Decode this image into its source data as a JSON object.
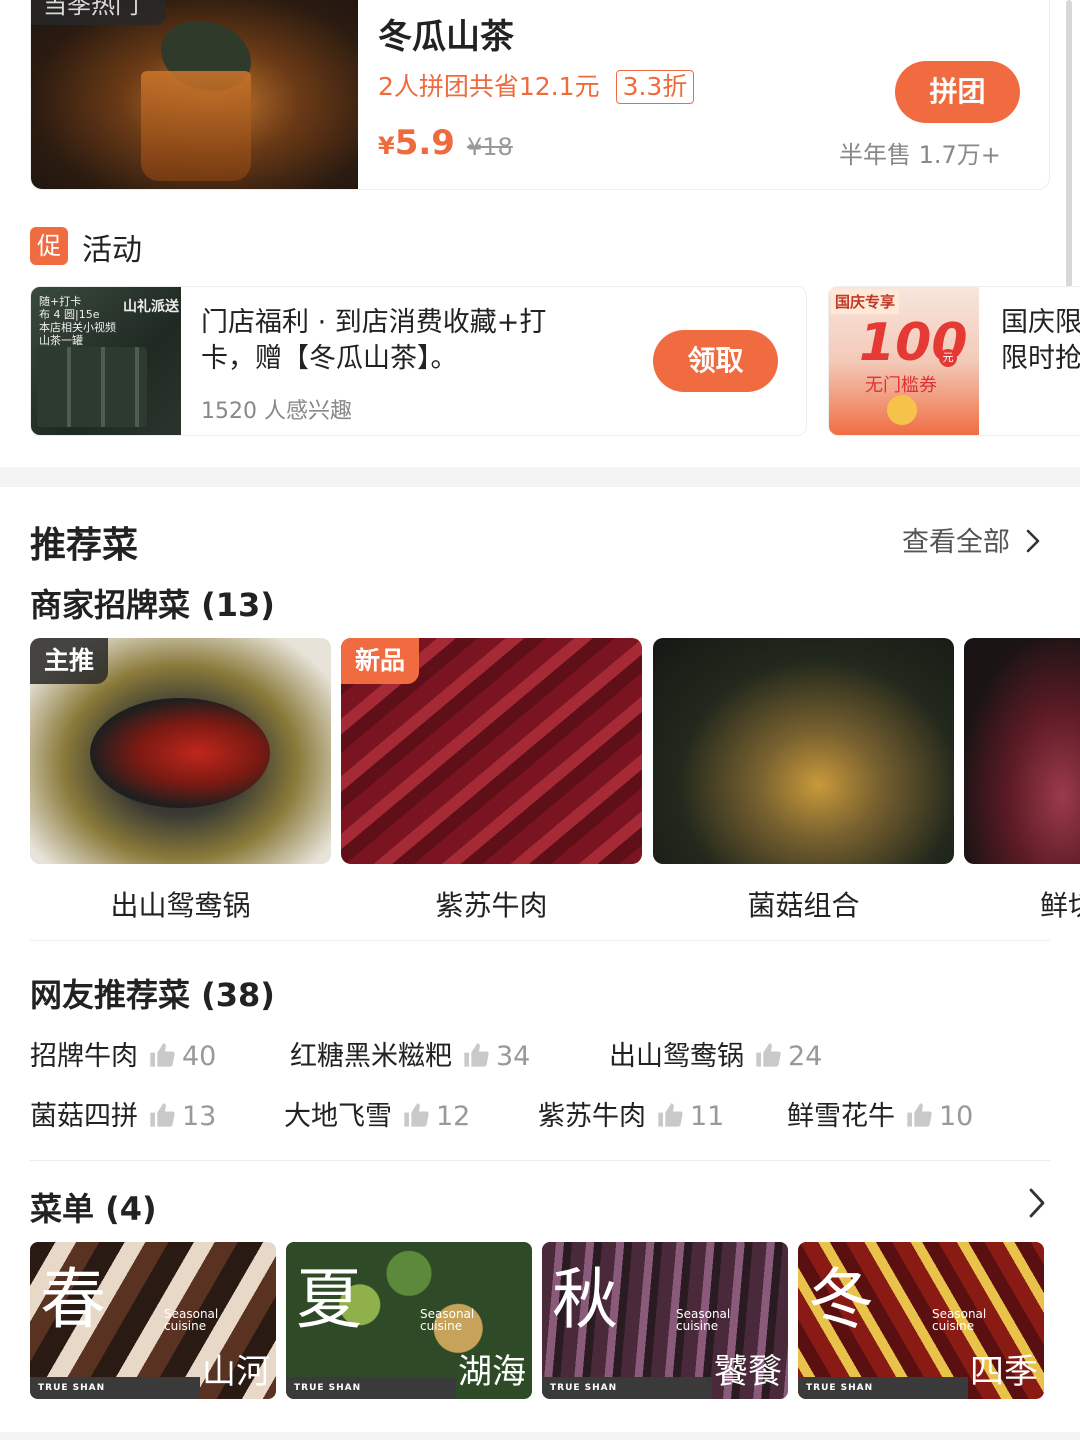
{
  "deal": {
    "tag": "当季热门",
    "title": "冬瓜山茶",
    "group_text": "2人拼团共省12.1元",
    "discount": "3.3折",
    "price_symbol": "¥",
    "price": "5.9",
    "original_price": "¥18",
    "button": "拼团",
    "sales": "半年售 1.7万+"
  },
  "activity": {
    "badge": "促",
    "title": "活动",
    "card1": {
      "image_brand": "山礼派送",
      "image_lines": [
        "随+打卡",
        "布 4 圆|15e",
        "本店相关小视频",
        "山茶一罐"
      ],
      "description": "门店福利 · 到店消费收藏+打卡，赠【冬瓜山茶】。",
      "interest": "1520 人感兴趣",
      "button": "领取"
    },
    "card2": {
      "coupon_tag": "国庆专享",
      "coupon_amount": "100",
      "coupon_unit": "元",
      "coupon_label": "无门槛券",
      "line1": "国庆限",
      "line2": "限时抢"
    }
  },
  "recommend": {
    "title": "推荐菜",
    "view_all": "查看全部",
    "signature_title": "商家招牌菜 (13)",
    "dishes": [
      {
        "name": "出山鸳鸯锅",
        "tag": "主推",
        "tag_color": "#333333"
      },
      {
        "name": "紫苏牛肉",
        "tag": "新品",
        "tag_color": "#f06b3f"
      },
      {
        "name": "菌菇组合",
        "tag": "",
        "tag_color": ""
      },
      {
        "name": "鲜切",
        "tag": "",
        "tag_color": ""
      }
    ],
    "netizen_title": "网友推荐菜 (38)",
    "netizen_items": [
      {
        "name": "招牌牛肉",
        "count": "40"
      },
      {
        "name": "红糖黑米糍粑",
        "count": "34"
      },
      {
        "name": "出山鸳鸯锅",
        "count": "24"
      },
      {
        "name": "菌菇四拼",
        "count": "13"
      },
      {
        "name": "大地飞雪",
        "count": "12"
      },
      {
        "name": "紫苏牛肉",
        "count": "11"
      },
      {
        "name": "鲜雪花牛",
        "count": "10"
      }
    ]
  },
  "menu": {
    "title": "菜单 (4)",
    "items": [
      {
        "season": "春",
        "pair": "山河",
        "sub1": "Seasonal",
        "sub2": "cuisine",
        "brand": "TRUE SHAN"
      },
      {
        "season": "夏",
        "pair": "湖海",
        "sub1": "Seasonal",
        "sub2": "cuisine",
        "brand": "TRUE SHAN"
      },
      {
        "season": "秋",
        "pair": "饕餮",
        "sub1": "Seasonal",
        "sub2": "cuisine",
        "brand": "TRUE SHAN"
      },
      {
        "season": "冬",
        "pair": "四季",
        "sub1": "Seasonal",
        "sub2": "cuisine",
        "brand": "TRUE SHAN"
      }
    ]
  },
  "colors": {
    "accent": "#f06b3f",
    "text": "#222222",
    "muted": "#999999"
  }
}
